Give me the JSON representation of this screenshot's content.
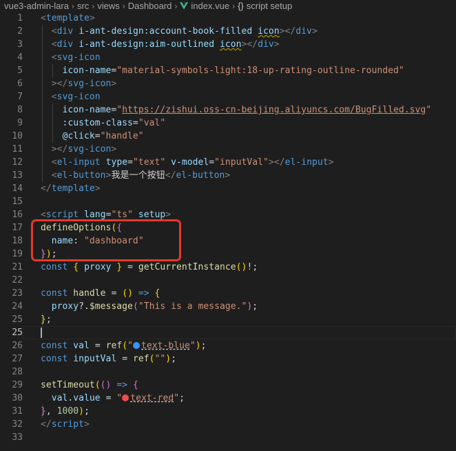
{
  "breadcrumb": {
    "project": "vue3-admin-lara",
    "seg1": "src",
    "seg2": "views",
    "seg3": "Dashboard",
    "file": "index.vue",
    "symbol": "script setup"
  },
  "editor": {
    "cursor_line": "25",
    "lines": [
      {
        "n": "1"
      },
      {
        "n": "2"
      },
      {
        "n": "3"
      },
      {
        "n": "4"
      },
      {
        "n": "5"
      },
      {
        "n": "6"
      },
      {
        "n": "7"
      },
      {
        "n": "8"
      },
      {
        "n": "9"
      },
      {
        "n": "10"
      },
      {
        "n": "11"
      },
      {
        "n": "12"
      },
      {
        "n": "13"
      },
      {
        "n": "14"
      },
      {
        "n": "15"
      },
      {
        "n": "16"
      },
      {
        "n": "17"
      },
      {
        "n": "18"
      },
      {
        "n": "19"
      },
      {
        "n": "21"
      },
      {
        "n": "22"
      },
      {
        "n": "23"
      },
      {
        "n": "24"
      },
      {
        "n": "25"
      },
      {
        "n": "26"
      },
      {
        "n": "27"
      },
      {
        "n": "28"
      },
      {
        "n": "29"
      },
      {
        "n": "30"
      },
      {
        "n": "31"
      },
      {
        "n": "32"
      },
      {
        "n": "33"
      }
    ],
    "tokens": {
      "template": "template",
      "div": "div",
      "attr_icon1": "i-ant-design:account-book-filled",
      "attr_icon2": "i-ant-design:aim-outlined",
      "icon": "icon",
      "svg_icon": "svg-icon",
      "icon_name": "icon-name",
      "icon_val1": "\"material-symbols-light:18-up-rating-outline-rounded\"",
      "icon_val2_url": "https://zishui.oss-cn-beijing.aliyuncs.com/BugFilled.svg",
      "custom_class": ":custom-class",
      "custom_class_val": "\"val\"",
      "click": "@click",
      "click_val": "\"handle\"",
      "el_input": "el-input",
      "type": "type",
      "type_val": "\"text\"",
      "vmodel": "v-model",
      "vmodel_val": "\"inputVal\"",
      "el_button": "el-button",
      "button_text": "我是一个按钮",
      "script": "script",
      "lang": "lang",
      "lang_val": "\"ts\"",
      "setup": "setup",
      "define_options": "defineOptions",
      "name_key": "name",
      "name_val": "\"dashboard\"",
      "const": "const",
      "proxy": "proxy",
      "get_instance": "getCurrentInstance",
      "handle": "handle",
      "arrow": "=>",
      "message": "$message",
      "message_str": "\"This is a message.\"",
      "val": "val",
      "ref": "ref",
      "text_blue": "text-blue",
      "input_val": "inputVal",
      "empty_str": "\"\"",
      "set_timeout": "setTimeout",
      "value": "value",
      "text_red": "text-red",
      "timeout_num": "1000"
    },
    "colors": {
      "blue_dot": "#3794ff",
      "red_dot": "#f14c4c",
      "highlight": "#e8382c"
    }
  }
}
